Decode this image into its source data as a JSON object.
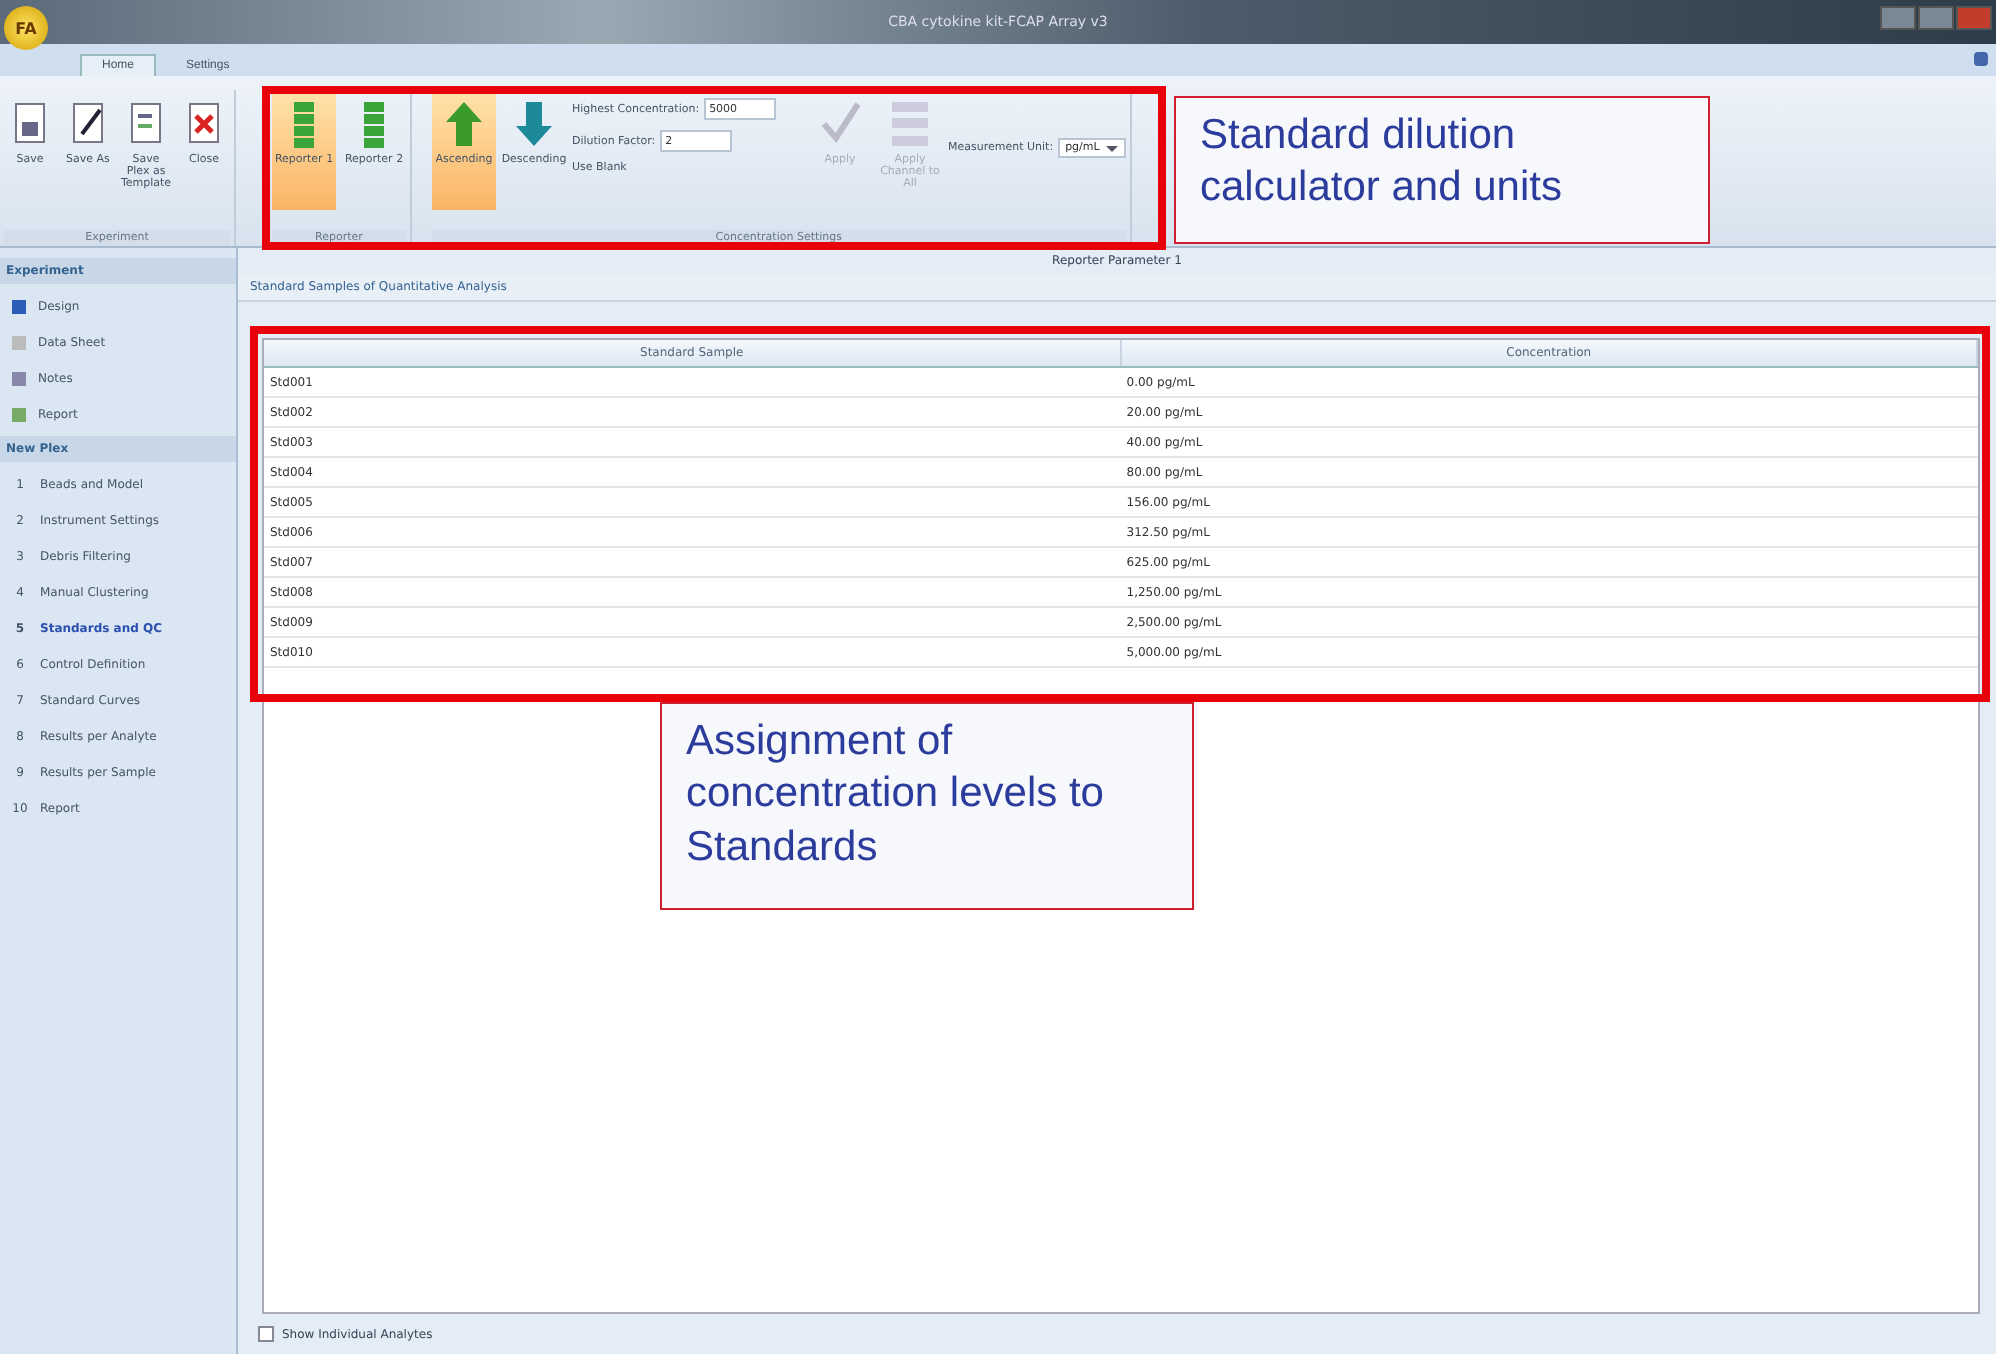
{
  "window": {
    "title": "CBA cytokine kit-FCAP Array v3",
    "logo_text": "FA"
  },
  "tabs": [
    {
      "label": "Home",
      "selected": true
    },
    {
      "label": "Settings",
      "selected": false
    }
  ],
  "ribbon": {
    "experiment_group": {
      "label": "Experiment",
      "buttons": [
        {
          "label": "Save",
          "kind": "save"
        },
        {
          "label": "Save As",
          "kind": "saveas"
        },
        {
          "label": "Save Plex as Template",
          "kind": "template"
        },
        {
          "label": "Close",
          "kind": "close"
        }
      ]
    },
    "reporter_group": {
      "label": "Reporter",
      "buttons": [
        {
          "label": "Reporter 1",
          "selected": true
        },
        {
          "label": "Reporter 2",
          "selected": false
        }
      ]
    },
    "order_buttons": [
      {
        "label": "Ascending",
        "kind": "up",
        "selected": true
      },
      {
        "label": "Descending",
        "kind": "down",
        "selected": false
      }
    ],
    "concentration_group": {
      "label": "Concentration Settings",
      "highest_concentration": {
        "label": "Highest Concentration:",
        "value": "5000"
      },
      "dilution_factor": {
        "label": "Dilution Factor:",
        "value": "2"
      },
      "use_blank": {
        "label": "Use Blank"
      },
      "actions": [
        {
          "label": "Apply",
          "kind": "check",
          "disabled": true
        },
        {
          "label": "Apply Channel to All",
          "kind": "list",
          "disabled": true
        }
      ]
    },
    "measurement_unit": {
      "label": "Measurement Unit:",
      "value": "pg/mL"
    }
  },
  "sidebar": {
    "sections": [
      {
        "title": "Experiment",
        "items": [
          {
            "label": "Design",
            "kind": "design",
            "selected": false
          },
          {
            "label": "Data Sheet",
            "kind": "sheet",
            "selected": false
          },
          {
            "label": "Notes",
            "kind": "notes",
            "selected": false
          },
          {
            "label": "Report",
            "kind": "report",
            "selected": false
          }
        ]
      },
      {
        "title": "New Plex",
        "items": [
          {
            "number": "1",
            "label": "Beads and Model",
            "selected": false
          },
          {
            "number": "2",
            "label": "Instrument Settings",
            "selected": false
          },
          {
            "number": "3",
            "label": "Debris Filtering",
            "selected": false
          },
          {
            "number": "4",
            "label": "Manual Clustering",
            "selected": false
          },
          {
            "number": "5",
            "label": "Standards and QC",
            "selected": true
          },
          {
            "number": "6",
            "label": "Control Definition",
            "selected": false
          },
          {
            "number": "7",
            "label": "Standard Curves",
            "selected": false
          },
          {
            "number": "8",
            "label": "Results per Analyte",
            "selected": false
          },
          {
            "number": "9",
            "label": "Results per Sample",
            "selected": false
          },
          {
            "number": "10",
            "label": "Report",
            "selected": false
          }
        ]
      }
    ]
  },
  "main": {
    "header": "Reporter Parameter 1",
    "section_title": "Standard Samples of Quantitative Analysis",
    "table": {
      "columns": [
        "Standard Sample",
        "Concentration"
      ],
      "rows": [
        [
          "Std001",
          "0.00 pg/mL"
        ],
        [
          "Std002",
          "20.00 pg/mL"
        ],
        [
          "Std003",
          "40.00 pg/mL"
        ],
        [
          "Std004",
          "80.00 pg/mL"
        ],
        [
          "Std005",
          "156.00 pg/mL"
        ],
        [
          "Std006",
          "312.50 pg/mL"
        ],
        [
          "Std007",
          "625.00 pg/mL"
        ],
        [
          "Std008",
          "1,250.00 pg/mL"
        ],
        [
          "Std009",
          "2,500.00 pg/mL"
        ],
        [
          "Std010",
          "5,000.00 pg/mL"
        ]
      ]
    },
    "show_individual": {
      "label": "Show Individual Analytes",
      "checked": false
    }
  },
  "annotations": [
    {
      "text": "Standard dilution calculator and units",
      "kind": "ribbon"
    },
    {
      "text": "Assignment of concentration levels to Standards",
      "kind": "table"
    }
  ]
}
